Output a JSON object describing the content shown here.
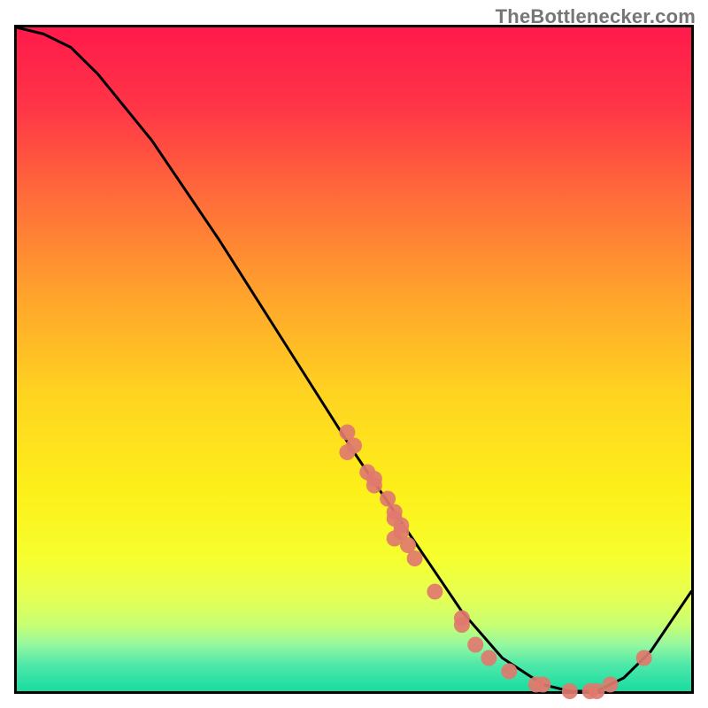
{
  "watermark": "TheBottlenecker.com",
  "chart_data": {
    "type": "line",
    "title": "",
    "xlabel": "",
    "ylabel": "",
    "xlim": [
      0,
      100
    ],
    "ylim": [
      0,
      100
    ],
    "grid": false,
    "series": [
      {
        "name": "curve",
        "color": "#000000",
        "x": [
          0,
          4,
          8,
          12,
          16,
          20,
          30,
          40,
          50,
          58,
          66,
          72,
          78,
          82,
          86,
          90,
          94,
          100
        ],
        "y": [
          100,
          99,
          97,
          93,
          88,
          83,
          68,
          52,
          36,
          24,
          12,
          5,
          1,
          0,
          0,
          2,
          6,
          15
        ]
      }
    ],
    "points": {
      "name": "markers",
      "color": "#e07a6e",
      "radius": 9,
      "xy": [
        [
          49,
          39
        ],
        [
          50,
          37
        ],
        [
          49,
          36
        ],
        [
          52,
          33
        ],
        [
          53,
          32
        ],
        [
          53,
          31
        ],
        [
          55,
          29
        ],
        [
          56,
          27
        ],
        [
          56,
          26
        ],
        [
          57,
          25
        ],
        [
          57,
          24
        ],
        [
          56,
          23
        ],
        [
          58,
          22
        ],
        [
          59,
          20
        ],
        [
          62,
          15
        ],
        [
          66,
          11
        ],
        [
          66,
          10
        ],
        [
          68,
          7
        ],
        [
          70,
          5
        ],
        [
          73,
          3
        ],
        [
          77,
          1
        ],
        [
          78,
          1
        ],
        [
          82,
          0
        ],
        [
          85,
          0
        ],
        [
          86,
          0
        ],
        [
          88,
          1
        ],
        [
          93,
          5
        ]
      ]
    },
    "background_gradient": {
      "type": "vertical",
      "stops": [
        {
          "pos": 0.0,
          "color": "#ff1a4b"
        },
        {
          "pos": 0.12,
          "color": "#ff3547"
        },
        {
          "pos": 0.25,
          "color": "#ff6a3a"
        },
        {
          "pos": 0.4,
          "color": "#ffa22c"
        },
        {
          "pos": 0.55,
          "color": "#ffd321"
        },
        {
          "pos": 0.7,
          "color": "#fdf01a"
        },
        {
          "pos": 0.8,
          "color": "#f6ff2f"
        },
        {
          "pos": 0.86,
          "color": "#e4ff55"
        },
        {
          "pos": 0.9,
          "color": "#c7ff72"
        },
        {
          "pos": 0.93,
          "color": "#95f7a0"
        },
        {
          "pos": 0.96,
          "color": "#4fe8a9"
        },
        {
          "pos": 1.0,
          "color": "#19dca0"
        }
      ]
    }
  }
}
